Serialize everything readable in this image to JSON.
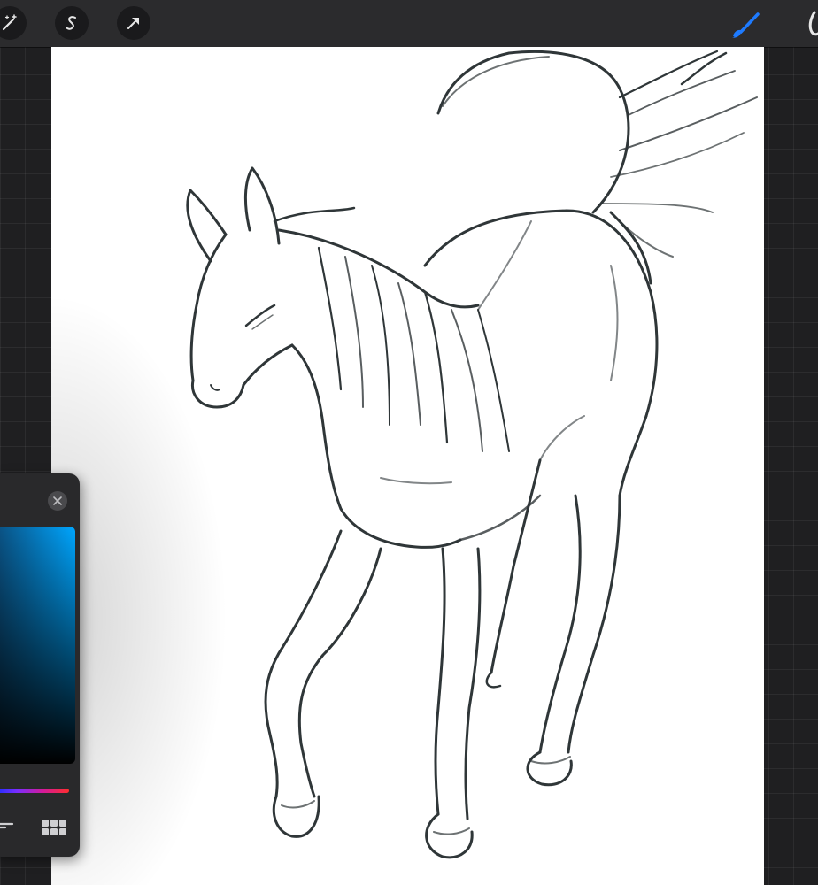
{
  "app": "drawing-canvas",
  "toolbar": {
    "left_tools": [
      {
        "name": "adjustments-wand-icon"
      },
      {
        "name": "selection-s-icon"
      },
      {
        "name": "transform-arrow-icon"
      }
    ],
    "right_tools": [
      {
        "name": "brush-icon",
        "active": true,
        "color": "#1e7bff"
      },
      {
        "name": "smudge-icon",
        "active": false
      }
    ]
  },
  "canvas": {
    "background": "#ffffff",
    "content": "horse sketch"
  },
  "color_panel": {
    "hue_accent": "#00a6ff",
    "close_icon": "close-x-icon",
    "bottom_icons": [
      "palette-list-icon",
      "palette-grid-icon"
    ]
  },
  "colors": {
    "ui_dark": "#2b2b2d",
    "background": "#1f1f21",
    "stroke": "#2f3638",
    "active_brush": "#1e7bff"
  }
}
